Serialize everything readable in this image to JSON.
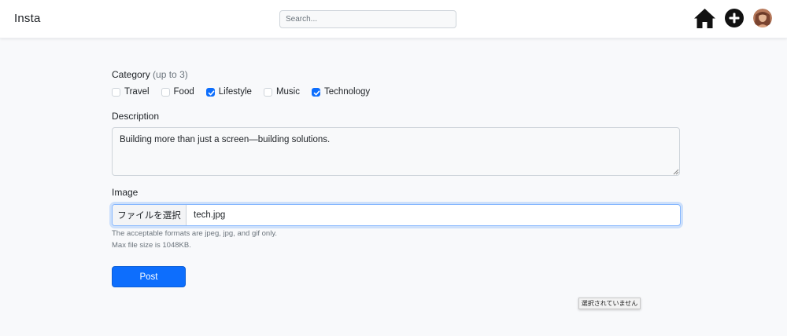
{
  "app": {
    "brand": "Insta"
  },
  "search": {
    "placeholder": "Search..."
  },
  "nav": {
    "icons": [
      "home-icon",
      "plus-circle-icon",
      "avatar"
    ]
  },
  "form": {
    "category": {
      "label": "Category",
      "hint": "(up to 3)",
      "options": [
        {
          "label": "Travel",
          "checked": false
        },
        {
          "label": "Food",
          "checked": false
        },
        {
          "label": "Lifestyle",
          "checked": true
        },
        {
          "label": "Music",
          "checked": false
        },
        {
          "label": "Technology",
          "checked": true
        }
      ]
    },
    "description": {
      "label": "Description",
      "value": "Building more than just a screen—building solutions."
    },
    "image": {
      "label": "Image",
      "button_label": "ファイルを選択",
      "file_name": "tech.jpg",
      "help_formats": "The acceptable formats are jpeg, jpg, and gif only.",
      "help_size": "Max file size is 1048KB."
    },
    "submit_label": "Post"
  },
  "tooltip": {
    "text": "選択されていません"
  },
  "colors": {
    "primary": "#0d6efd",
    "background": "#f8f9fb",
    "navbar": "#ffffff"
  }
}
